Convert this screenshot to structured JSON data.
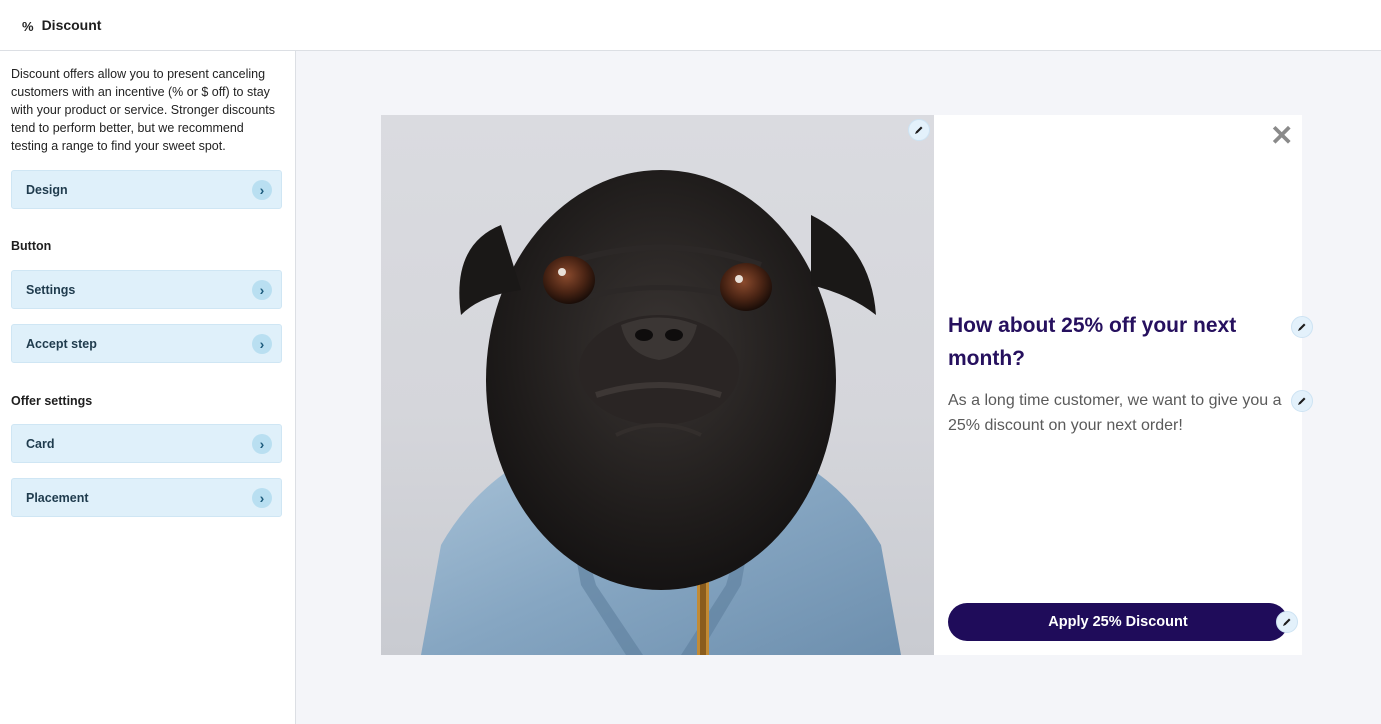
{
  "header": {
    "icon_glyph": "%",
    "icon": "percent-icon",
    "title": "Discount"
  },
  "sidebar": {
    "intro": "Discount offers allow you to present canceling customers with an incentive (% or $ off) to stay with your product or service. Stronger discounts tend to perform better, but we recommend testing a range to find your sweet spot.",
    "design_label": "Design",
    "button_section_label": "Button",
    "settings_label": "Settings",
    "accept_step_label": "Accept step",
    "offer_section_label": "Offer settings",
    "card_label": "Card",
    "placement_label": "Placement",
    "chevron_glyph": "›"
  },
  "preview": {
    "close_glyph": "✕",
    "headline": "How about 25% off your next month?",
    "body": "As a long time customer, we want to give you a 25% discount on your next order!",
    "cta_label": "Apply 25% Discount",
    "image": "black-pug-in-denim-jacket-photo",
    "edit_icon": "pencil-icon"
  },
  "colors": {
    "accent": "#1f0c5a",
    "headline": "#26105e",
    "panel_bg": "#dff0fa",
    "canvas_bg": "#f4f5f9"
  }
}
